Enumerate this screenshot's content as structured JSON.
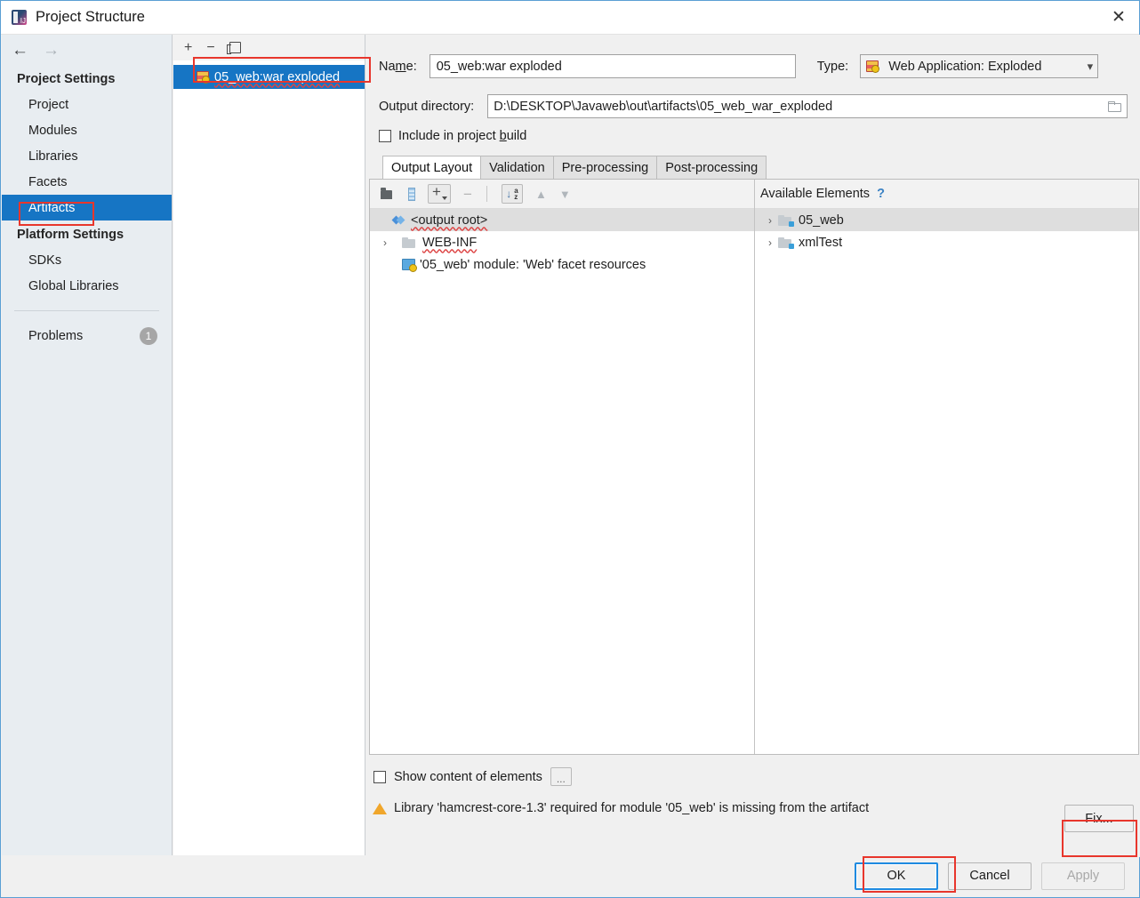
{
  "window": {
    "title": "Project Structure",
    "app_icon": "intellij-idea-icon",
    "close_label": "✕"
  },
  "sidebar": {
    "back_arrow": "←",
    "forward_arrow": "→",
    "groups": [
      {
        "title": "Project Settings",
        "items": [
          {
            "label": "Project",
            "selected": false
          },
          {
            "label": "Modules",
            "selected": false
          },
          {
            "label": "Libraries",
            "selected": false
          },
          {
            "label": "Facets",
            "selected": false
          },
          {
            "label": "Artifacts",
            "selected": true
          }
        ]
      },
      {
        "title": "Platform Settings",
        "items": [
          {
            "label": "SDKs",
            "selected": false
          },
          {
            "label": "Global Libraries",
            "selected": false
          }
        ]
      }
    ],
    "problems": {
      "label": "Problems",
      "count": "1"
    },
    "help_label": "?"
  },
  "artifact_panel": {
    "toolbar": {
      "add_label": "+",
      "remove_label": "−",
      "copy_name": "copy-icon"
    },
    "items": [
      {
        "label": "05_web:war exploded",
        "selected": true,
        "icon": "artifact-war-icon"
      }
    ]
  },
  "form": {
    "name_label": "Name:",
    "name_value": "05_web:war exploded",
    "type_label": "Type:",
    "type_value": "Web Application: Exploded",
    "type_icon": "web-application-icon",
    "output_dir_label": "Output directory:",
    "output_dir_value": "D:\\DESKTOP\\Javaweb\\out\\artifacts\\05_web_war_exploded",
    "browse_icon": "folder-browse-icon",
    "include_in_build_label": "Include in project build",
    "include_in_build_checked": false
  },
  "tabs": [
    {
      "label": "Output Layout",
      "active": true
    },
    {
      "label": "Validation",
      "active": false
    },
    {
      "label": "Pre-processing",
      "active": false
    },
    {
      "label": "Post-processing",
      "active": false
    }
  ],
  "layout_toolbar": [
    {
      "name": "add-directory-icon",
      "label": ""
    },
    {
      "name": "add-library-icon",
      "label": ""
    },
    {
      "name": "add-dropdown-icon",
      "label": "+"
    },
    {
      "name": "remove-icon",
      "label": "−"
    },
    {
      "name": "sort-az-icon",
      "label": ""
    },
    {
      "name": "move-up-icon",
      "label": "▲"
    },
    {
      "name": "move-down-icon",
      "label": "▼"
    }
  ],
  "output_tree": [
    {
      "label": "<output root>",
      "icon": "output-root-icon",
      "indent": 0,
      "selected": true,
      "twisty": ""
    },
    {
      "label": "WEB-INF",
      "icon": "folder-icon",
      "indent": 1,
      "selected": false,
      "twisty": "›"
    },
    {
      "label": "'05_web' module: 'Web' facet resources",
      "icon": "module-facet-icon",
      "indent": 1,
      "selected": false,
      "twisty": ""
    }
  ],
  "available_elements": {
    "title": "Available Elements",
    "help": "?",
    "items": [
      {
        "label": "05_web",
        "icon": "module-folder-icon",
        "twisty": "›",
        "selected": true
      },
      {
        "label": "xmlTest",
        "icon": "module-folder-icon",
        "twisty": "›",
        "selected": false
      }
    ]
  },
  "bottom": {
    "show_content_label": "Show content of elements",
    "show_content_checked": false,
    "dots_label": "...",
    "warning_text": "Library 'hamcrest-core-1.3' required for module '05_web' is missing from the artifact",
    "warning_icon": "warning-triangle-icon",
    "fix_label": "Fix..."
  },
  "footer": {
    "ok_label": "OK",
    "cancel_label": "Cancel",
    "apply_label": "Apply",
    "apply_enabled": false
  },
  "colors": {
    "selection_blue": "#1675c4",
    "annotation_red": "#e8362c",
    "warning_amber": "#f0a62b",
    "focus_blue": "#1f8ae0"
  }
}
